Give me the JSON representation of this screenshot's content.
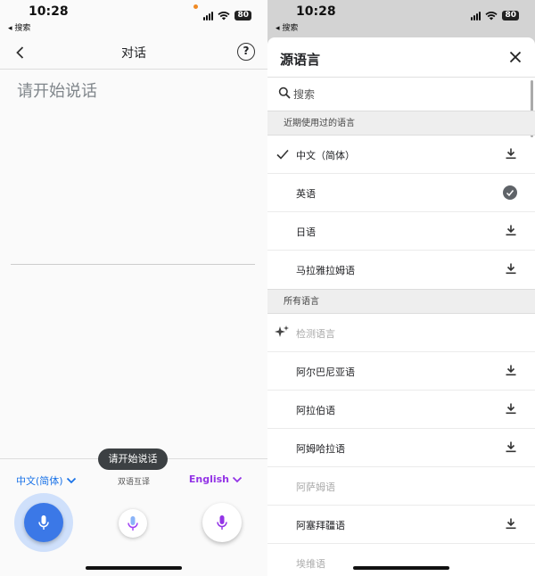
{
  "left": {
    "status": {
      "time": "10:28",
      "back_app": "◂ 搜索",
      "battery": "80"
    },
    "header": {
      "title": "对话",
      "help": "?"
    },
    "prompt": "请开始说话",
    "tooltip": "请开始说话",
    "source_language": "中文(简体)",
    "mode_label": "双语互译",
    "target_language": "English"
  },
  "right": {
    "status": {
      "time": "10:28",
      "back_app": "◂ 搜索",
      "battery": "80"
    },
    "sheet_title": "源语言",
    "search_placeholder": "搜索",
    "recent_section": "近期使用过的语言",
    "recent": [
      {
        "label": "中文（简体）",
        "selected": true,
        "action": "download"
      },
      {
        "label": "英语",
        "selected": false,
        "action": "downloaded"
      },
      {
        "label": "日语",
        "selected": false,
        "action": "download"
      },
      {
        "label": "马拉雅拉姆语",
        "selected": false,
        "action": "download"
      }
    ],
    "all_section": "所有语言",
    "detect_label": "检测语言",
    "all": [
      {
        "label": "阿尔巴尼亚语",
        "action": "download"
      },
      {
        "label": "阿拉伯语",
        "action": "download"
      },
      {
        "label": "阿姆哈拉语",
        "action": "download"
      },
      {
        "label": "阿萨姆语",
        "action": "none"
      },
      {
        "label": "阿塞拜疆语",
        "action": "download"
      },
      {
        "label": "埃维语",
        "action": "none"
      }
    ]
  },
  "colors": {
    "accent_blue": "#3b78e7",
    "accent_purple": "#9334e6"
  }
}
